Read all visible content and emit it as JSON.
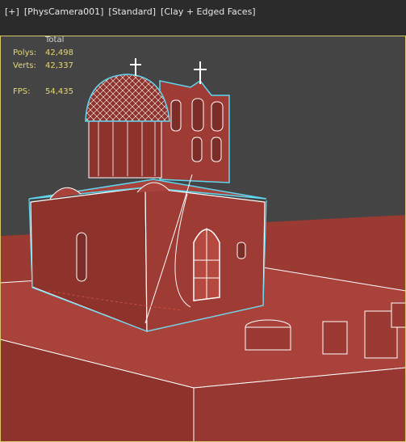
{
  "viewport": {
    "menu": {
      "plus": "[+]",
      "camera": "[PhysCamera001]",
      "shading": "[Standard]",
      "display": "[Clay + Edged Faces]"
    },
    "stats": {
      "header": "Total",
      "polys_label": "Polys:",
      "polys_value": "42,498",
      "verts_label": "Verts:",
      "verts_value": "42,337",
      "fps_label": "FPS:",
      "fps_value": "54,435"
    },
    "colors": {
      "background": "#444444",
      "clay": "#9b3a33",
      "edges": "#ffffff",
      "selection_outline": "#5fd7f0",
      "stats_text": "#e6d870",
      "viewport_border": "#d8c86a"
    }
  }
}
